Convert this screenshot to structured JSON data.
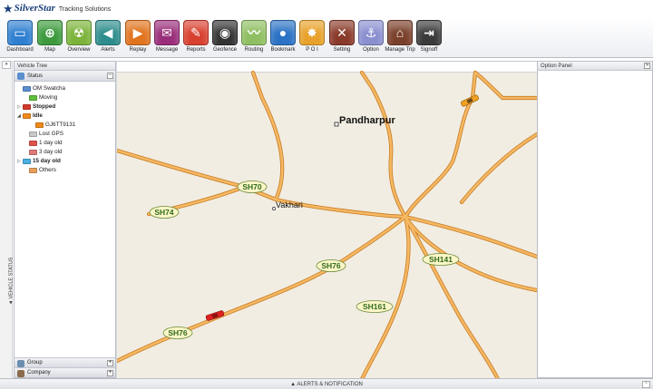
{
  "header": {
    "brand": "SilverStar",
    "tagline": "Tracking Solutions"
  },
  "toolbar": {
    "items": [
      {
        "label": "Dashboard",
        "icon": "monitor-icon",
        "color": "#2f7fd0",
        "glyph": "▭"
      },
      {
        "label": "Map",
        "icon": "globe-icon",
        "color": "#3c9a3c",
        "glyph": "⊕"
      },
      {
        "label": "Overview",
        "icon": "radiation-icon",
        "color": "#7bb33a",
        "glyph": "☢"
      },
      {
        "label": "Alerts",
        "icon": "megaphone-icon",
        "color": "#2d8c8c",
        "glyph": "◀"
      },
      {
        "label": "Replay",
        "icon": "clapperboard-icon",
        "color": "#e0731e",
        "glyph": "▶"
      },
      {
        "label": "Message",
        "icon": "envelope-icon",
        "color": "#9a2e7a",
        "glyph": "✉"
      },
      {
        "label": "Reports",
        "icon": "chart-pen-icon",
        "color": "#d8402f",
        "glyph": "✎"
      },
      {
        "label": "Geofence",
        "icon": "car-fence-icon",
        "color": "#333333",
        "glyph": "◉"
      },
      {
        "label": "Routing",
        "icon": "route-chart-icon",
        "color": "#8fbf63",
        "glyph": "〰"
      },
      {
        "label": "Bookmark",
        "icon": "earth-bookmark-icon",
        "color": "#2b72c4",
        "glyph": "●"
      },
      {
        "label": "P O I",
        "icon": "star-burst-icon",
        "color": "#e8a12a",
        "glyph": "✸"
      },
      {
        "label": "Setting",
        "icon": "tools-icon",
        "color": "#8a3a2a",
        "glyph": "✕"
      },
      {
        "label": "Option",
        "icon": "anchor-icon",
        "color": "#8a8fd0",
        "glyph": "⚓"
      },
      {
        "label": "Manage Trip",
        "icon": "trip-icon",
        "color": "#7a3f2a",
        "glyph": "⌂"
      },
      {
        "label": "Signoff",
        "icon": "signoff-icon",
        "color": "#3a3a3a",
        "glyph": "⇥"
      }
    ]
  },
  "vehicle_tree": {
    "title": "Vehicle Tree",
    "status_label": "Status",
    "vertical_tab": "◄ VEHICLE STATUS",
    "rows": [
      {
        "label": "OM Swatcha",
        "bold": false,
        "color": "#5a8fd0",
        "arrow": ""
      },
      {
        "label": "Moving",
        "bold": false,
        "color": "#5fbf3c",
        "arrow": ""
      },
      {
        "label": "Stopped",
        "bold": true,
        "color": "#d33a2a",
        "arrow": "▷"
      },
      {
        "label": "Idle",
        "bold": true,
        "color": "#f08a1a",
        "arrow": "◢"
      },
      {
        "label": "GJ6TT9131",
        "bold": false,
        "color": "#f08a1a",
        "arrow": ""
      },
      {
        "label": "Lost GPS",
        "bold": false,
        "color": "#c8c8c8",
        "arrow": ""
      },
      {
        "label": "1 day old",
        "bold": false,
        "color": "#e0524a",
        "arrow": ""
      },
      {
        "label": "3 day old",
        "bold": false,
        "color": "#e07a7a",
        "arrow": ""
      },
      {
        "label": "15 day old",
        "bold": true,
        "color": "#4ab0e0",
        "arrow": "▷"
      },
      {
        "label": "Others",
        "bold": false,
        "color": "#e8a05a",
        "arrow": ""
      }
    ],
    "group_label": "Group",
    "company_label": "Company"
  },
  "map": {
    "cities": [
      {
        "name": "Pandharpur"
      },
      {
        "name": "Vakhari"
      }
    ],
    "shields": [
      "SH70",
      "SH74",
      "SH76",
      "SH141",
      "SH161",
      "SH76"
    ]
  },
  "option_panel": {
    "title": "Option Panel"
  },
  "alerts": {
    "label": "▲ ALERTS & NOTIFICATION"
  },
  "colors": {
    "road": "#f0a64a",
    "road_edge": "#c97a22",
    "map_bg": "#f1ede2",
    "shield_bg": "#fbf6c8",
    "shield_text": "#2f6a1a"
  }
}
